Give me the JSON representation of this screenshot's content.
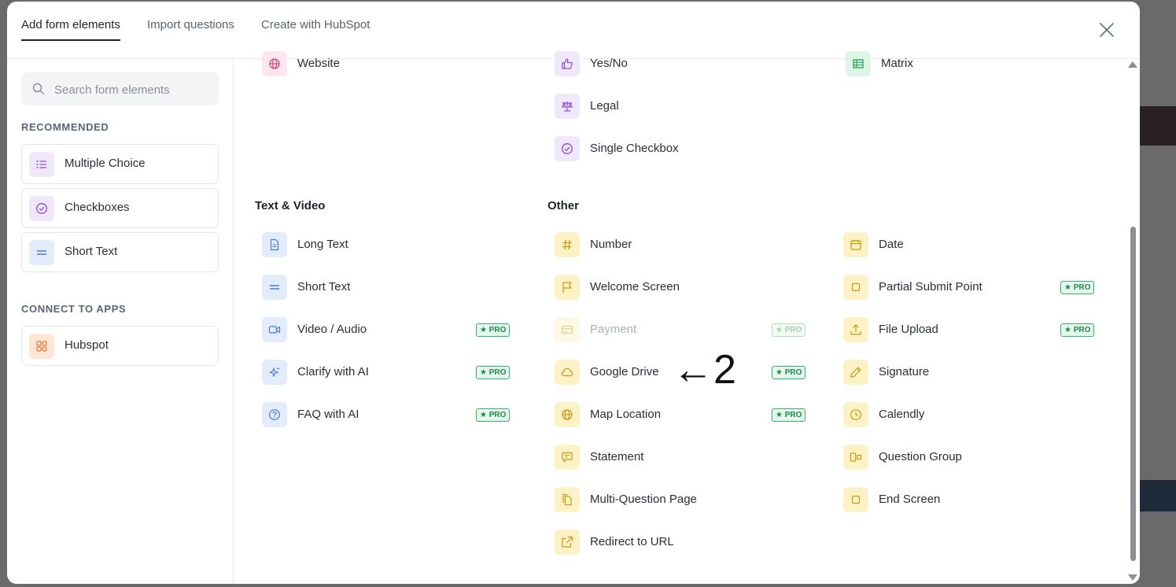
{
  "tabs": [
    {
      "label": "Add form elements",
      "active": true
    },
    {
      "label": "Import questions",
      "active": false
    },
    {
      "label": "Create with HubSpot",
      "active": false
    }
  ],
  "search": {
    "placeholder": "Search form elements"
  },
  "sidebar": {
    "recommended_label": "RECOMMENDED",
    "recommended": [
      {
        "label": "Multiple Choice",
        "icon": "list-icon"
      },
      {
        "label": "Checkboxes",
        "icon": "check-circle-icon"
      },
      {
        "label": "Short Text",
        "icon": "short-text-icon"
      }
    ],
    "connect_label": "CONNECT TO APPS",
    "apps": [
      {
        "label": "Hubspot",
        "icon": "grid-icon"
      }
    ]
  },
  "top_items": {
    "col1": [
      {
        "label": "Website",
        "icon": "globe-icon"
      }
    ],
    "col2": [
      {
        "label": "Yes/No",
        "icon": "thumbs-up-icon"
      },
      {
        "label": "Legal",
        "icon": "scale-icon"
      },
      {
        "label": "Single Checkbox",
        "icon": "check-circle-icon"
      }
    ],
    "col3": [
      {
        "label": "Matrix",
        "icon": "table-icon"
      }
    ]
  },
  "groups": {
    "text_video": {
      "title": "Text & Video",
      "items": [
        {
          "label": "Long Text",
          "icon": "document-icon",
          "pro": false
        },
        {
          "label": "Short Text",
          "icon": "short-text-icon",
          "pro": false
        },
        {
          "label": "Video / Audio",
          "icon": "video-icon",
          "pro": true
        },
        {
          "label": "Clarify with AI",
          "icon": "sparkle-icon",
          "pro": true
        },
        {
          "label": "FAQ with AI",
          "icon": "question-icon",
          "pro": true
        }
      ]
    },
    "other": {
      "title": "Other",
      "col2": [
        {
          "label": "Number",
          "icon": "hash-icon",
          "pro": false
        },
        {
          "label": "Welcome Screen",
          "icon": "flag-icon",
          "pro": false
        },
        {
          "label": "Payment",
          "icon": "credit-card-icon",
          "pro": true,
          "disabled": true
        },
        {
          "label": "Google Drive",
          "icon": "cloud-icon",
          "pro": true
        },
        {
          "label": "Map Location",
          "icon": "globe-icon",
          "pro": true
        },
        {
          "label": "Statement",
          "icon": "chat-icon",
          "pro": false
        },
        {
          "label": "Multi-Question Page",
          "icon": "pages-icon",
          "pro": false
        },
        {
          "label": "Redirect to URL",
          "icon": "external-link-icon",
          "pro": false
        }
      ],
      "col3": [
        {
          "label": "Date",
          "icon": "calendar-icon",
          "pro": false
        },
        {
          "label": "Partial Submit Point",
          "icon": "square-icon",
          "pro": true
        },
        {
          "label": "File Upload",
          "icon": "upload-icon",
          "pro": true
        },
        {
          "label": "Signature",
          "icon": "pen-icon",
          "pro": false
        },
        {
          "label": "Calendly",
          "icon": "clock-icon",
          "pro": false
        },
        {
          "label": "Question Group",
          "icon": "group-icon",
          "pro": false
        },
        {
          "label": "End Screen",
          "icon": "square-icon",
          "pro": false
        }
      ]
    }
  },
  "pro_label": "★ PRO",
  "annotation": "←2"
}
